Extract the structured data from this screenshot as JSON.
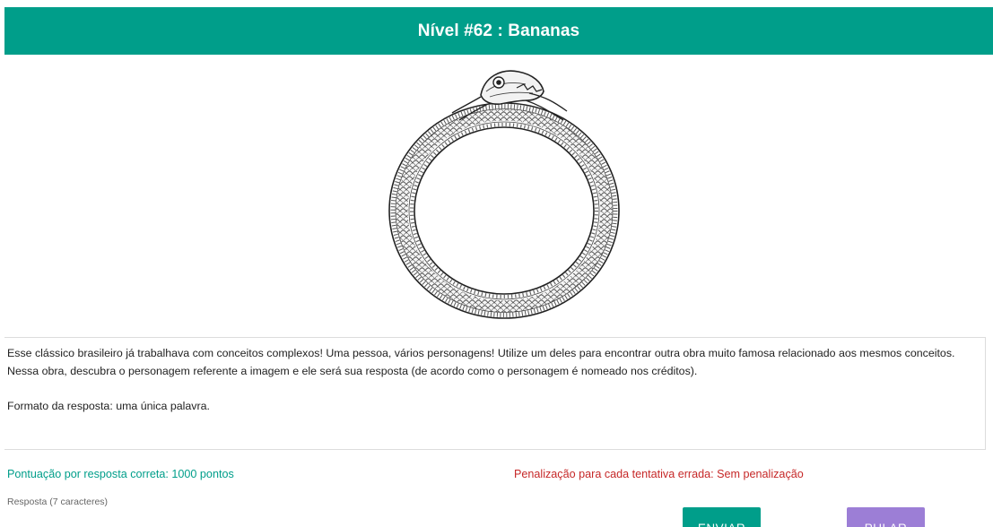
{
  "header": {
    "title": "Nível #62 : Bananas"
  },
  "image": {
    "icon": "ouroboros-snake-image"
  },
  "description": {
    "text": "Esse clássico brasileiro já trabalhava com conceitos complexos! Uma pessoa, vários personagens! Utilize um deles para encontrar outra obra muito famosa relacionado aos mesmos conceitos. Nessa obra, descubra o personagem referente a imagem e ele será sua resposta (de acordo como o personagem é nomeado nos créditos).",
    "format": "Formato da resposta: uma única palavra."
  },
  "scoring": {
    "points_text": "Pontuação por resposta correta: 1000 pontos",
    "penalty_text": "Penalização para cada tentativa errada: Sem penalização"
  },
  "answer": {
    "label": "Resposta (7 caracteres)"
  },
  "buttons": {
    "send_label": "ENVIAR",
    "skip_label": "PULAR"
  },
  "colors": {
    "primary": "#009e8a",
    "penalty": "#c62828",
    "skip": "#9c7ed6"
  }
}
